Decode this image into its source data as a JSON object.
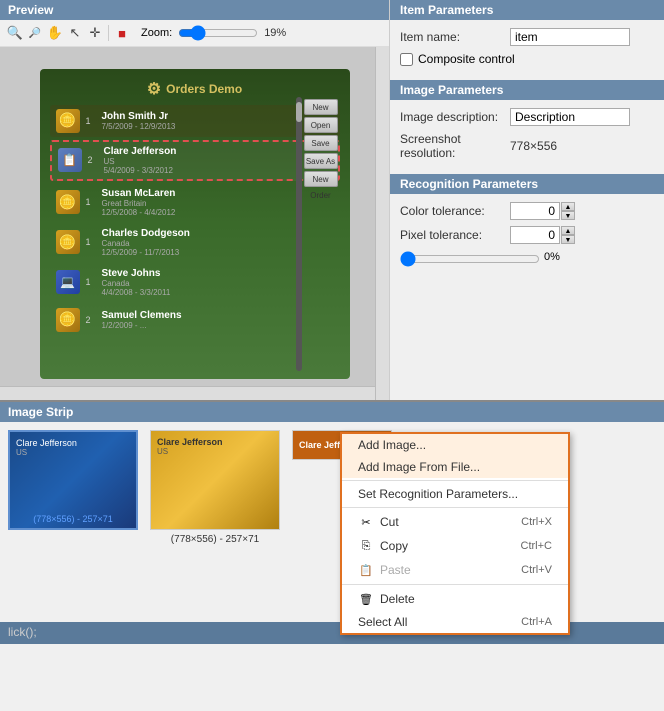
{
  "preview": {
    "header": "Preview",
    "zoom_label": "Zoom:",
    "zoom_value": "19%",
    "app_title": "Orders Demo",
    "list_items": [
      {
        "num": "1",
        "name": "John Smith Jr",
        "sub": "",
        "date": "7/5/2009 - 12/9/2013",
        "selected": false
      },
      {
        "num": "2",
        "name": "Clare Jefferson",
        "sub": "US",
        "date": "5/4/2009 - 3/3/2012",
        "selected": true
      },
      {
        "num": "1",
        "name": "Susan McLaren",
        "sub": "Great Britain",
        "date": "12/5/2008 - 4/4/2012",
        "selected": false
      },
      {
        "num": "1",
        "name": "Charles Dodgeson",
        "sub": "Canada",
        "date": "12/5/2009 - 11/7/2013",
        "selected": false
      },
      {
        "num": "1",
        "name": "Steve Johns",
        "sub": "Canada",
        "date": "4/4/2008 - 3/3/2011",
        "selected": false
      },
      {
        "num": "2",
        "name": "Samuel Clemens",
        "sub": "",
        "date": "1/2/2009 - ...",
        "selected": false
      }
    ],
    "buttons": [
      "New",
      "Open",
      "Save",
      "Save As",
      "New Order"
    ]
  },
  "item_parameters": {
    "header": "Item Parameters",
    "item_name_label": "Item name:",
    "item_name_value": "item",
    "composite_label": "Composite control"
  },
  "image_parameters": {
    "header": "Image Parameters",
    "desc_label": "Image description:",
    "desc_value": "Description",
    "res_label": "Screenshot resolution:",
    "res_value": "778×556"
  },
  "recognition_parameters": {
    "header": "Recognition Parameters",
    "color_label": "Color tolerance:",
    "color_value": "0",
    "pixel_label": "Pixel tolerance:",
    "pixel_value": "0",
    "slider_pct": "0%"
  },
  "image_strip": {
    "header": "Image Strip",
    "item1": {
      "label": "Clare Jefferson",
      "sub": "US",
      "size": "(778×556) - 257×71"
    },
    "item2": {
      "label": "Clare Jefferson",
      "sub": "US",
      "size": "(778×556) - 257×71"
    },
    "item3": {
      "label": "Clare Jefferson"
    }
  },
  "context_menu": {
    "add_image": "Add Image...",
    "add_image_file": "Add Image From File...",
    "set_recognition": "Set Recognition Parameters...",
    "cut": "Cut",
    "cut_shortcut": "Ctrl+X",
    "copy": "Copy",
    "copy_shortcut": "Ctrl+C",
    "paste": "Paste",
    "paste_shortcut": "Ctrl+V",
    "delete": "Delete",
    "select_all": "Select All",
    "select_all_shortcut": "Ctrl+A"
  },
  "code_bar": {
    "text": "lick();"
  }
}
